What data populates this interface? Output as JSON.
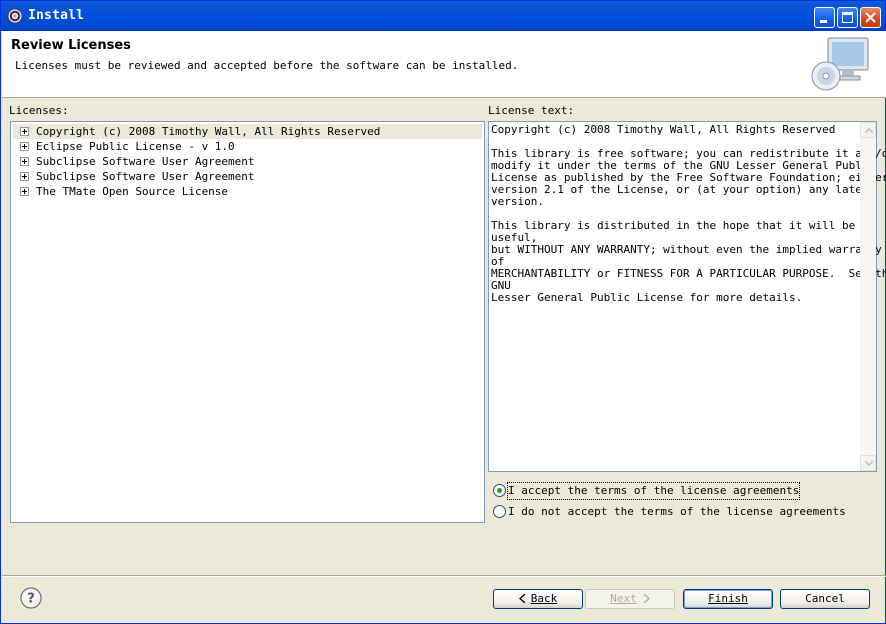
{
  "window": {
    "title": "Install"
  },
  "header": {
    "title": "Review Licenses",
    "description": "Licenses must be reviewed and accepted before the software can be installed."
  },
  "licenses": {
    "label": "Licenses:",
    "items": [
      {
        "label": "Copyright (c) 2008 Timothy Wall, All Rights Reserved",
        "selected": true
      },
      {
        "label": "Eclipse Public License - v 1.0",
        "selected": false
      },
      {
        "label": "Subclipse Software User Agreement",
        "selected": false
      },
      {
        "label": "Subclipse Software User Agreement",
        "selected": false
      },
      {
        "label": "The TMate Open Source License",
        "selected": false
      }
    ]
  },
  "license_text": {
    "label": "License text:",
    "content": "Copyright (c) 2008 Timothy Wall, All Rights Reserved\n\nThis library is free software; you can redistribute it and/or\nmodify it under the terms of the GNU Lesser General Public\nLicense as published by the Free Software Foundation; either\nversion 2.1 of the License, or (at your option) any later\nversion.\n\nThis library is distributed in the hope that it will be\nuseful,\nbut WITHOUT ANY WARRANTY; without even the implied warranty\nof\nMERCHANTABILITY or FITNESS FOR A PARTICULAR PURPOSE.  See the\nGNU\nLesser General Public License for more details."
  },
  "agreement": {
    "accept_label": "I accept the terms of the license agreements",
    "decline_label": "I do not accept the terms of the license agreements",
    "selected": "accept"
  },
  "buttons": {
    "back": "Back",
    "next": "Next",
    "finish": "Finish",
    "cancel": "Cancel"
  },
  "colors": {
    "titlebar": "#0050e0",
    "dialog_bg": "#ece9d8",
    "field_border": "#7f9db9",
    "radio_dot": "#21a121"
  }
}
